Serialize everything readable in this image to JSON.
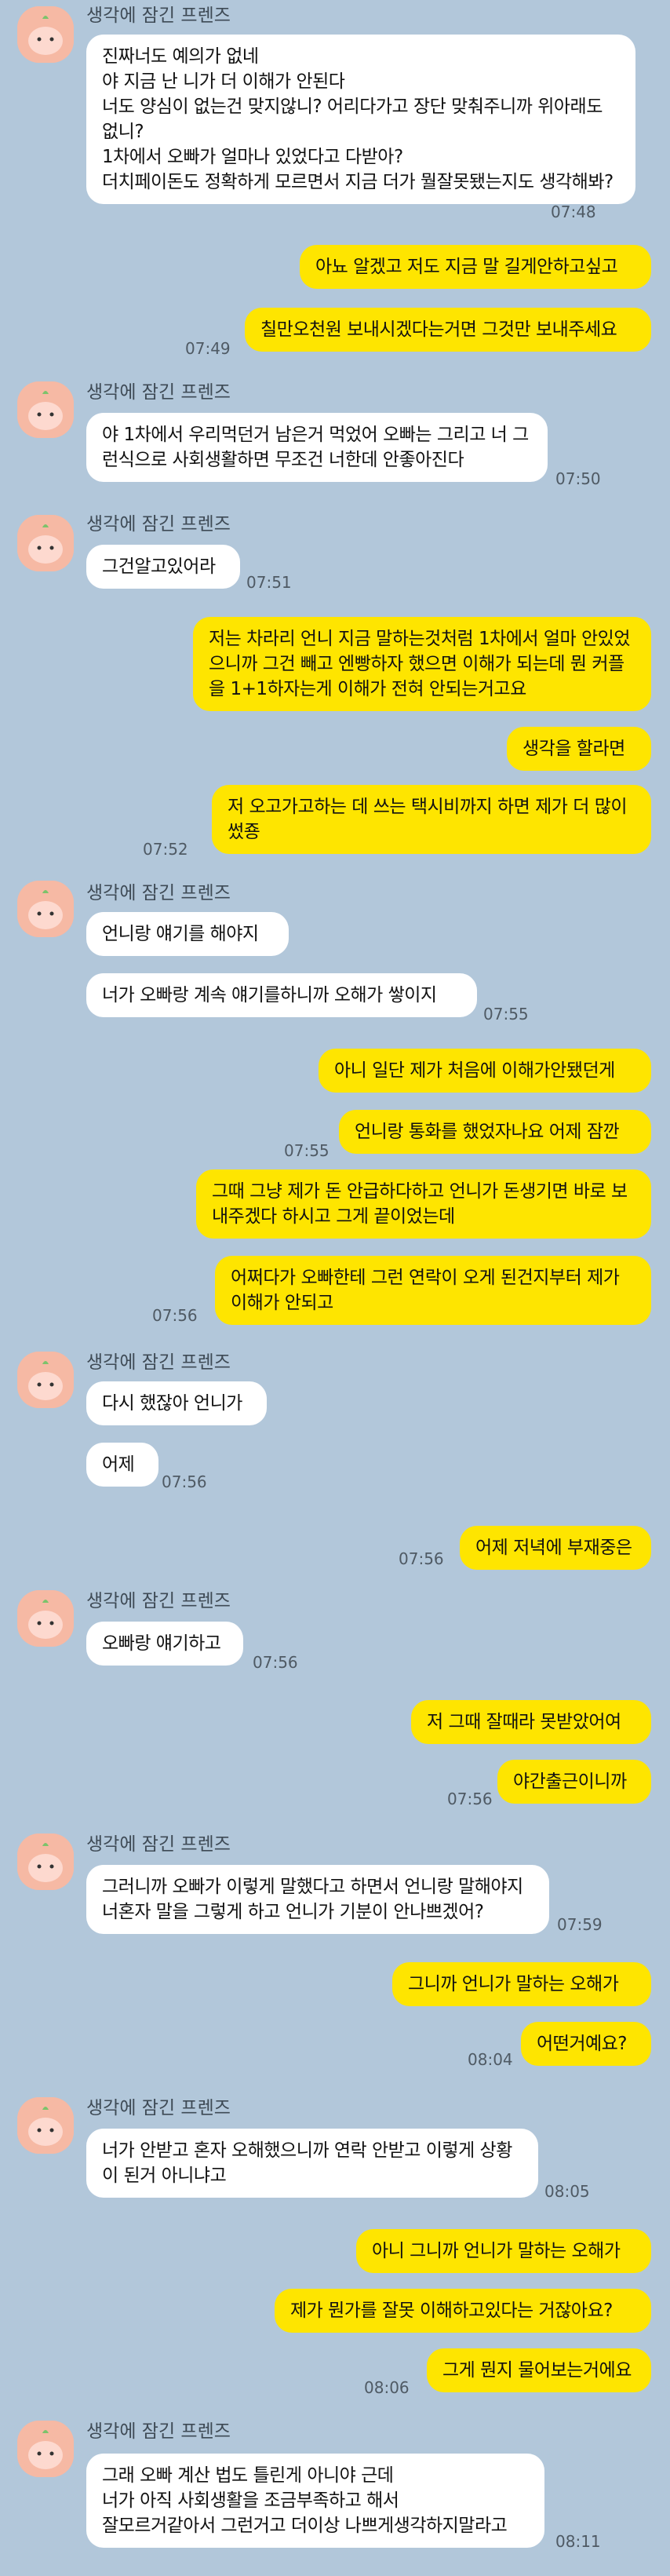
{
  "sender_name": "생각에 잠긴 프렌즈",
  "messages": [
    {
      "text": "진짜너도 예의가 없네\n야 지금 난 니가 더 이해가 안된다\n너도 양심이 없는건 맞지않니? 어리다가고 장단 맞춰주니까 위아래도 없니?\n1차에서 오빠가 얼마나 있었다고 다받아?\n더치페이돈도 정확하게 모르면서 지금 더가 뭘잘못됐는지도 생각해봐?"
    },
    {
      "time": "07:48"
    },
    {
      "text": "아뇨 알겠고 저도 지금 말 길게안하고싶고"
    },
    {
      "text": "칠만오천원 보내시겠다는거면 그것만 보내주세요"
    },
    {
      "time": "07:49"
    },
    {
      "text": "야 1차에서 우리먹던거 남은거 먹었어 오빠는 그리고 너 그런식으로 사회생활하면 무조건 너한데 안좋아진다"
    },
    {
      "time": "07:50"
    },
    {
      "text": "그건알고있어라"
    },
    {
      "time": "07:51"
    },
    {
      "text": "저는 차라리 언니 지금 말하는것처럼 1차에서 얼마 안있었으니까 그건 빼고 엔빵하자 했으면 이해가 되는데 뭔 커플을 1+1하자는게 이해가 전혀 안되는거고요"
    },
    {
      "text": "생각을 할라면"
    },
    {
      "text": "저 오고가고하는 데 쓰는 택시비까지 하면 제가 더 많이 썼죵"
    },
    {
      "time": "07:52"
    },
    {
      "text": "언니랑 얘기를 해야지"
    },
    {
      "text": "너가 오빠랑 계속 얘기를하니까 오해가 쌓이지"
    },
    {
      "time": "07:55"
    },
    {
      "text": "아니 일단 제가 처음에 이해가안됐던게"
    },
    {
      "text": "언니랑 통화를 했었자나요 어제 잠깐"
    },
    {
      "time": "07:55"
    },
    {
      "text": "그때 그냥 제가 돈 안급하다하고 언니가 돈생기면 바로 보내주겠다 하시고 그게 끝이었는데"
    },
    {
      "text": "어쩌다가 오빠한테 그런 연락이 오게 된건지부터 제가 이해가 안되고"
    },
    {
      "time": "07:56"
    },
    {
      "text": "다시 했잖아 언니가"
    },
    {
      "text": "어제"
    },
    {
      "time": "07:56"
    },
    {
      "text": "어제 저녁에 부재중은"
    },
    {
      "time": "07:56"
    },
    {
      "text": "오빠랑 얘기하고"
    },
    {
      "time": "07:56"
    },
    {
      "text": "저 그때 잘때라 못받았어여"
    },
    {
      "text": "야간출근이니까"
    },
    {
      "time": "07:56"
    },
    {
      "text": "그러니까 오빠가 이렇게 말했다고 하면서 언니랑 말해야지 너혼자 말을 그렇게 하고 언니가 기분이 안나쁘겠어?"
    },
    {
      "time": "07:59"
    },
    {
      "text": "그니까 언니가 말하는 오해가"
    },
    {
      "text": "어떤거예요?"
    },
    {
      "time": "08:04"
    },
    {
      "text": "너가 안받고 혼자 오해했으니까 연락 안받고 이렇게 상황이 된거 아니냐고"
    },
    {
      "time": "08:05"
    },
    {
      "text": "아니 그니까 언니가 말하는 오해가"
    },
    {
      "text": "제가 뭔가를 잘못 이해하고있다는 거잖아요?"
    },
    {
      "text": "그게 뭔지 물어보는거에요"
    },
    {
      "time": "08:06"
    },
    {
      "text": "그래 오빠 계산 법도 틀린게 아니야 근데\n너가 아직 사회생활을 조금부족하고 해서\n잘모르거같아서 그런거고 더이상 나쁘게생각하지말라고"
    },
    {
      "time": "08:11"
    }
  ]
}
